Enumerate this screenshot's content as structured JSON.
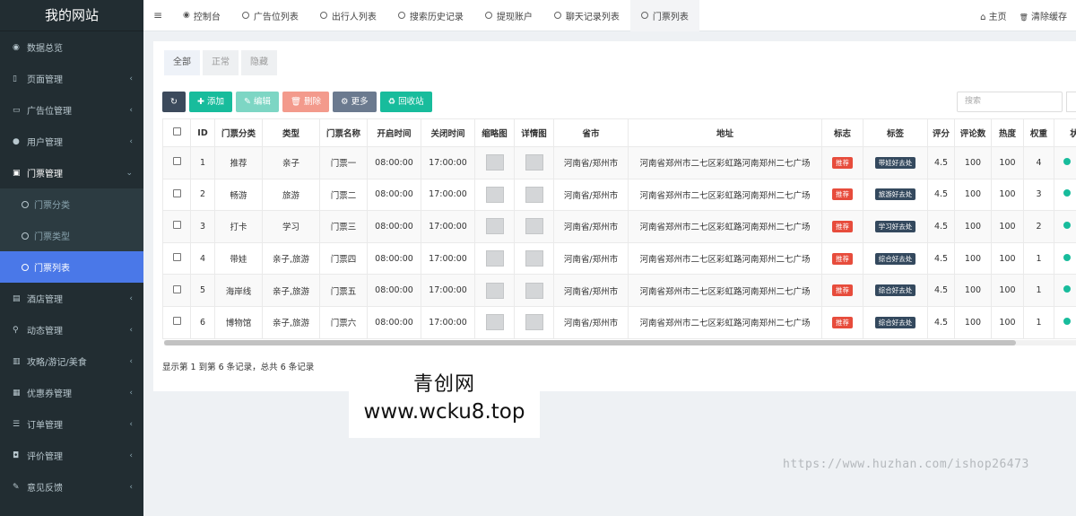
{
  "brand": "我的网站",
  "sidebar": {
    "items": [
      {
        "icon": "dashboard-icon",
        "glyph": "◉",
        "label": "数据总览",
        "caret": ""
      },
      {
        "icon": "bookmark-icon",
        "glyph": "▯",
        "label": "页面管理",
        "caret": "‹"
      },
      {
        "icon": "card-icon",
        "glyph": "▭",
        "label": "广告位管理",
        "caret": "‹"
      },
      {
        "icon": "user-icon",
        "glyph": "●",
        "label": "用户管理",
        "caret": "‹"
      },
      {
        "icon": "ticket-icon",
        "glyph": "▣",
        "label": "门票管理",
        "caret": "⌄"
      },
      {
        "icon": "hotel-icon",
        "glyph": "▤",
        "label": "酒店管理",
        "caret": "‹"
      },
      {
        "icon": "walk-icon",
        "glyph": "⚲",
        "label": "动态管理",
        "caret": "‹"
      },
      {
        "icon": "guide-icon",
        "glyph": "▥",
        "label": "攻略/游记/美食",
        "caret": "‹"
      },
      {
        "icon": "coupon-icon",
        "glyph": "▦",
        "label": "优惠券管理",
        "caret": "‹"
      },
      {
        "icon": "order-icon",
        "glyph": "☰",
        "label": "订单管理",
        "caret": "‹"
      },
      {
        "icon": "review-icon",
        "glyph": "◘",
        "label": "评价管理",
        "caret": "‹"
      },
      {
        "icon": "feedback-icon",
        "glyph": "✎",
        "label": "意见反馈",
        "caret": "‹"
      }
    ],
    "subitems": [
      "门票分类",
      "门票类型",
      "门票列表"
    ]
  },
  "topbar": {
    "menu_glyph": "≡",
    "tabs": [
      {
        "label": "控制台",
        "icon": "dashboard-icon",
        "glyph": "◉"
      },
      {
        "label": "广告位列表",
        "icon": "circle-icon"
      },
      {
        "label": "出行人列表",
        "icon": "circle-icon"
      },
      {
        "label": "搜索历史记录",
        "icon": "circle-icon"
      },
      {
        "label": "提现账户",
        "icon": "circle-icon"
      },
      {
        "label": "聊天记录列表",
        "icon": "circle-icon"
      },
      {
        "label": "门票列表",
        "icon": "circle-icon"
      }
    ],
    "home": "主页",
    "home_glyph": "⌂",
    "clear_cache": "清除缓存",
    "clear_glyph": "🗑"
  },
  "subtabs": [
    "全部",
    "正常",
    "隐藏"
  ],
  "toolbar": {
    "refresh_glyph": "↻",
    "add": "✚ 添加",
    "edit": "✎ 编辑",
    "delete": "🗑 删除",
    "more": "⚙ 更多",
    "recycle": "♻ 回收站"
  },
  "search": {
    "placeholder": "搜索"
  },
  "table": {
    "headers": [
      "ID",
      "门票分类",
      "类型",
      "门票名称",
      "开启时间",
      "关闭时间",
      "缩略图",
      "详情图",
      "省市",
      "地址",
      "标志",
      "标签",
      "评分",
      "评论数",
      "热度",
      "权重",
      "状"
    ],
    "rows": [
      {
        "id": "1",
        "category": "推荐",
        "type": "亲子",
        "name": "门票一",
        "open": "08:00:00",
        "close": "17:00:00",
        "region": "河南省/郑州市",
        "address": "河南省郑州市二七区彩虹路河南郑州二七广场",
        "flag": "推荐",
        "tag": "带娃好去处",
        "score": "4.5",
        "comments": "100",
        "heat": "100",
        "weight": "4"
      },
      {
        "id": "2",
        "category": "畅游",
        "type": "旅游",
        "name": "门票二",
        "open": "08:00:00",
        "close": "17:00:00",
        "region": "河南省/郑州市",
        "address": "河南省郑州市二七区彩虹路河南郑州二七广场",
        "flag": "推荐",
        "tag": "旅游好去处",
        "score": "4.5",
        "comments": "100",
        "heat": "100",
        "weight": "3"
      },
      {
        "id": "3",
        "category": "打卡",
        "type": "学习",
        "name": "门票三",
        "open": "08:00:00",
        "close": "17:00:00",
        "region": "河南省/郑州市",
        "address": "河南省郑州市二七区彩虹路河南郑州二七广场",
        "flag": "推荐",
        "tag": "学习好去处",
        "score": "4.5",
        "comments": "100",
        "heat": "100",
        "weight": "2"
      },
      {
        "id": "4",
        "category": "带娃",
        "type": "亲子,旅游",
        "name": "门票四",
        "open": "08:00:00",
        "close": "17:00:00",
        "region": "河南省/郑州市",
        "address": "河南省郑州市二七区彩虹路河南郑州二七广场",
        "flag": "推荐",
        "tag": "综合好去处",
        "score": "4.5",
        "comments": "100",
        "heat": "100",
        "weight": "1"
      },
      {
        "id": "5",
        "category": "海岸线",
        "type": "亲子,旅游",
        "name": "门票五",
        "open": "08:00:00",
        "close": "17:00:00",
        "region": "河南省/郑州市",
        "address": "河南省郑州市二七区彩虹路河南郑州二七广场",
        "flag": "推荐",
        "tag": "综合好去处",
        "score": "4.5",
        "comments": "100",
        "heat": "100",
        "weight": "1"
      },
      {
        "id": "6",
        "category": "博物馆",
        "type": "亲子,旅游",
        "name": "门票六",
        "open": "08:00:00",
        "close": "17:00:00",
        "region": "河南省/郑州市",
        "address": "河南省郑州市二七区彩虹路河南郑州二七广场",
        "flag": "推荐",
        "tag": "综合好去处",
        "score": "4.5",
        "comments": "100",
        "heat": "100",
        "weight": "1"
      }
    ]
  },
  "pager": "显示第 1 到第 6 条记录，总共 6 条记录",
  "watermark": {
    "line1": "青创网",
    "line2": "www.wcku8.top"
  },
  "url_mark": "https://www.huzhan.com/ishop26473",
  "colors": {
    "sidebar": "#222d32",
    "active": "#4a78e8",
    "green": "#18bc9c",
    "red": "#e74c3c",
    "tag": "#34495e"
  }
}
